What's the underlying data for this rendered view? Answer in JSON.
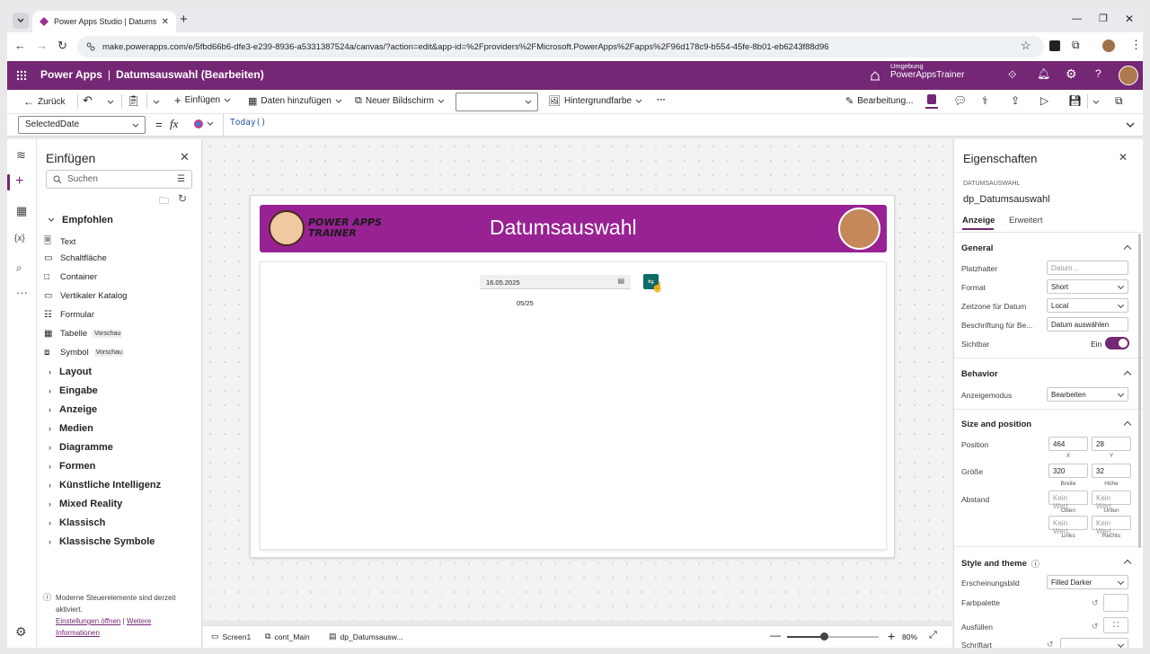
{
  "browser": {
    "tab_title": "Power Apps Studio | Datumsa...",
    "url": "make.powerapps.com/e/5fbd66b6-dfe3-e239-8936-a5331387524a/canvas/?action=edit&app-id=%2Fproviders%2FMicrosoft.PowerApps%2Fapps%2F96d178c9-b554-45fe-8b01-eb6243f88d96"
  },
  "app_header": {
    "product": "Power Apps",
    "separator": "|",
    "title": "Datumsauswahl (Bearbeiten)",
    "env_label": "Umgebung",
    "env_name": "PowerAppsTrainer"
  },
  "toolbar": {
    "back": "Zurück",
    "insert": "Einfügen",
    "add_data": "Daten hinzufügen",
    "new_screen": "Neuer Bildschirm",
    "background": "Hintergrundfarbe",
    "more": "···",
    "editing": "Bearbeitung..."
  },
  "formula": {
    "property": "SelectedDate",
    "equals": "=",
    "fx": "fx",
    "expression": "Today()"
  },
  "insert_panel": {
    "title": "Einfügen",
    "search_placeholder": "Suchen",
    "recommended": "Empfohlen",
    "items": [
      {
        "label": "Text",
        "icon": "text-icon"
      },
      {
        "label": "Schaltfläche",
        "icon": "button-icon"
      },
      {
        "label": "Container",
        "icon": "container-icon"
      },
      {
        "label": "Vertikaler Katalog",
        "icon": "gallery-icon"
      },
      {
        "label": "Formular",
        "icon": "form-icon"
      },
      {
        "label": "Tabelle",
        "icon": "table-icon",
        "badge": "Vorschau"
      },
      {
        "label": "Symbol",
        "icon": "shapes-icon",
        "badge": "Vorschau"
      }
    ],
    "categories": [
      "Layout",
      "Eingabe",
      "Anzeige",
      "Medien",
      "Diagramme",
      "Formen",
      "Künstliche Intelligenz",
      "Mixed Reality",
      "Klassisch",
      "Klassische Symbole"
    ],
    "footer_text": "Moderne Steuerelemente sind derzeit aktiviert.",
    "footer_link1": "Einstellungen öffnen",
    "footer_sep": "|",
    "footer_link2": "Weitere Informationen"
  },
  "canvas": {
    "banner_logo_line1": "POWER APPS",
    "banner_logo_line2": "TRAINER",
    "banner_title": "Datumsauswahl",
    "date_value": "16.05.2025",
    "month_label": "05/25",
    "colors": {
      "banner": "#982293",
      "button": "#0f6b66"
    }
  },
  "properties": {
    "title": "Eigenschaften",
    "control_type": "DATUMSAUSWAHL",
    "control_name": "dp_Datumsauswahl",
    "tab_display": "Anzeige",
    "tab_advanced": "Erweitert",
    "general": "General",
    "placeholder_label": "Platzhalter",
    "placeholder_value": "Datum...",
    "format_label": "Format",
    "format_value": "Short",
    "timezone_label": "Zeitzone für Datum",
    "timezone_value": "Local",
    "caption_label": "Beschriftung für Be...",
    "caption_value": "Datum auswählen",
    "visible_label": "Sichtbar",
    "visible_value": "Ein",
    "behavior": "Behavior",
    "mode_label": "Anzeigemodus",
    "mode_value": "Bearbeiten",
    "size_position": "Size and position",
    "position_label": "Position",
    "pos_x": "464",
    "pos_y": "28",
    "x_cap": "X",
    "y_cap": "Y",
    "size_label": "Größe",
    "width": "320",
    "height": "32",
    "width_cap": "Breite",
    "height_cap": "Höhe",
    "padding_label": "Abstand",
    "no_value": "Kein Wert.",
    "top_cap": "Oben",
    "bottom_cap": "Unten",
    "left_cap": "Links",
    "right_cap": "Rechts",
    "style_theme": "Style and theme",
    "appearance_label": "Erscheinungsbild",
    "appearance_value": "Filled Darker",
    "palette_label": "Farbpalette",
    "fill_label": "Ausfüllen",
    "font_label": "Schriftart"
  },
  "status": {
    "crumb1": "Screen1",
    "crumb2": "cont_Main",
    "crumb3": "dp_Datumsausw...",
    "zoom_percent": "80%",
    "zoom_level": 0.8
  }
}
